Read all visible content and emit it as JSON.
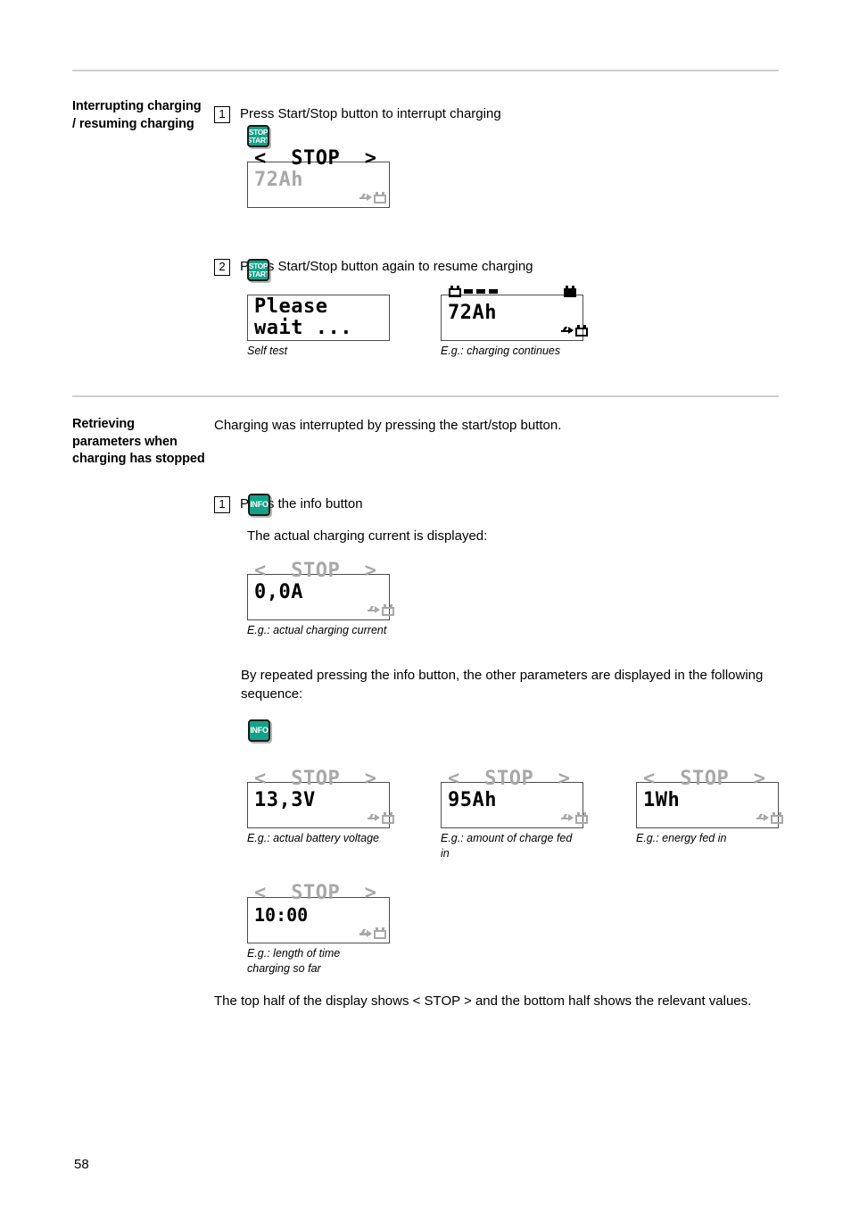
{
  "document": {
    "page_number": "58"
  },
  "sections": [
    {
      "heading": "Interrupting charging / resuming charging",
      "steps": [
        {
          "number": "1",
          "text": "Press Start/Stop button to interrupt charging",
          "button": {
            "name": "stop-start-button",
            "line1": "STOP",
            "line2": "START"
          }
        },
        {
          "number": "2",
          "text": "Press Start/Stop button again to resume charging",
          "button": {
            "name": "stop-start-button",
            "line1": "STOP",
            "line2": "START"
          }
        }
      ],
      "display_1": {
        "top": "<  STOP  >",
        "bottom_value": "72Ah",
        "bottom_suffix_icon": "arrow-to-battery-icon"
      },
      "display_2a": {
        "top": "Please",
        "bottom": "wait ...",
        "caption": "Self test"
      },
      "display_2b": {
        "top_icon": "battery-charging-animation-icon",
        "bottom_value": "72Ah",
        "bottom_suffix_icon": "arrow-to-battery-icon",
        "caption": "E.g.: charging continues"
      }
    },
    {
      "heading": "Retrieving parameters when charging has stopped",
      "intro": "Charging was interrupted by pressing the start/stop button.",
      "step": {
        "number": "1",
        "text": "Press the info button"
      },
      "info_button": {
        "name": "info-button",
        "label": "INFO"
      },
      "after_info_text": "The actual charging current is displayed:",
      "display_current": {
        "top": "<  STOP  >",
        "bottom_value": "0,0A",
        "caption": "E.g.: actual charging current"
      },
      "repeat_text": "By repeated pressing the info button, the other parameters are displayed in the following sequence:",
      "info_button_2": {
        "name": "info-button",
        "label": "INFO"
      },
      "sequence_displays": [
        {
          "top": "<  STOP  >",
          "bottom_value": "13,3V",
          "caption": "E.g.: actual battery voltage"
        },
        {
          "top": "<  STOP  >",
          "bottom_value": "95Ah",
          "caption": "E.g.: amount of charge fed in"
        },
        {
          "top": "<  STOP  >",
          "bottom_value": "1Wh",
          "caption": "E.g.: energy fed in"
        },
        {
          "top": "<  STOP  >",
          "bottom_value": "10:00",
          "caption": "E.g.: length of time charging so far"
        }
      ],
      "closing_text": "The top half of the display shows < STOP > and the bottom half shows the relevant values."
    }
  ],
  "colors": {
    "key_button_green": "#13a287",
    "key_button_border": "#1a1a1a",
    "lcd_border": "#4d4d4d",
    "lcd_inactive_text": "#a8a8a8",
    "rule": "#cfcfcf"
  }
}
